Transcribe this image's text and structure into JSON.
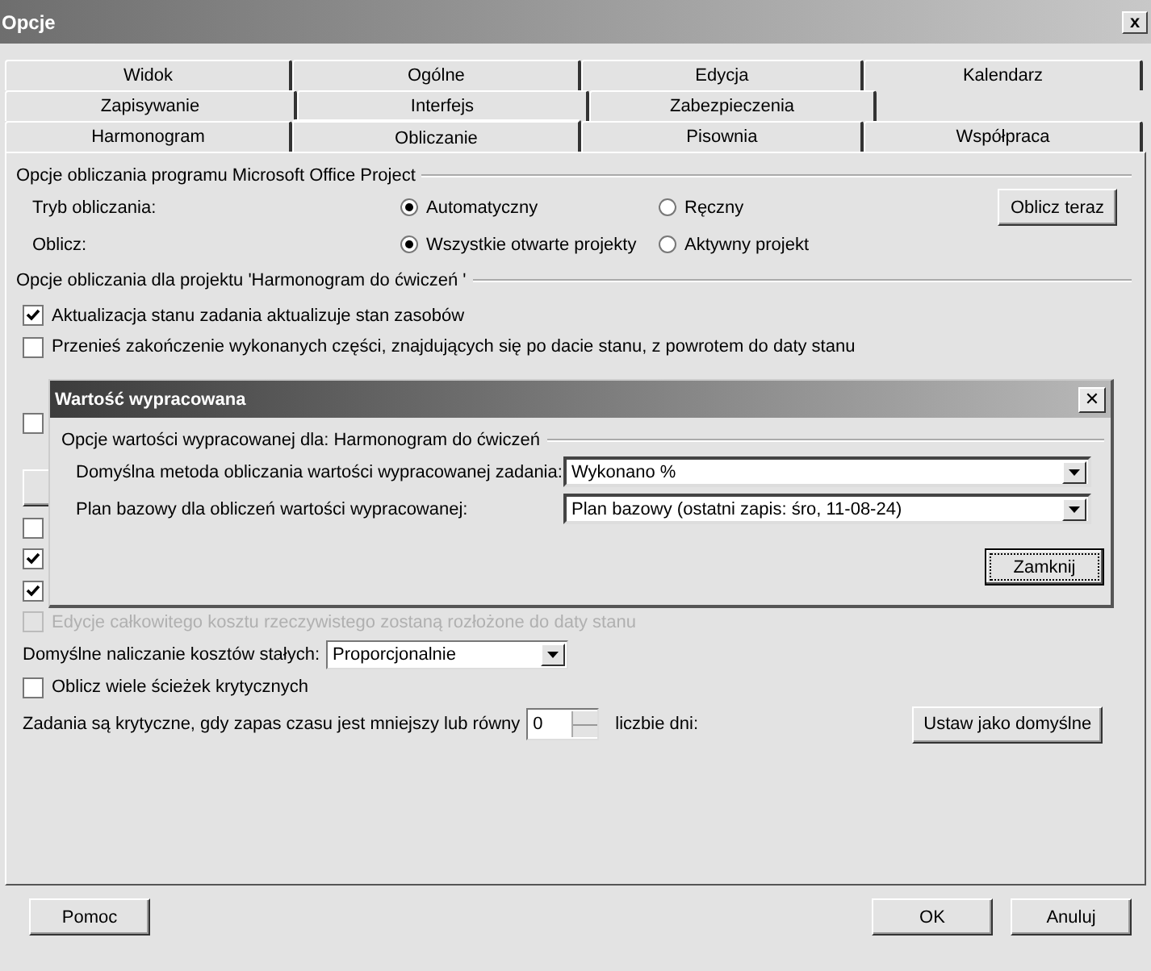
{
  "window": {
    "title": "Opcje",
    "close": "x"
  },
  "tabs": [
    [
      {
        "label": "Widok",
        "selected": false
      },
      {
        "label": "Ogólne",
        "selected": false
      },
      {
        "label": "Edycja",
        "selected": false
      },
      {
        "label": "Kalendarz",
        "selected": false
      }
    ],
    [
      {
        "label": "Zapisywanie",
        "selected": false
      },
      {
        "label": "Interfejs",
        "selected": false
      },
      {
        "label": "Zabezpieczenia",
        "selected": false
      }
    ],
    [
      {
        "label": "Harmonogram",
        "selected": false
      },
      {
        "label": "Obliczanie",
        "selected": true
      },
      {
        "label": "Pisownia",
        "selected": false
      },
      {
        "label": "Współpraca",
        "selected": false
      }
    ]
  ],
  "program_group": {
    "title": "Opcje obliczania programu Microsoft Office Project",
    "rows": [
      {
        "label": "Tryb obliczania:",
        "options": [
          {
            "label": "Automatyczny",
            "selected": true
          },
          {
            "label": "Ręczny",
            "selected": false
          }
        ],
        "button": "Oblicz teraz"
      },
      {
        "label": "Oblicz:",
        "options": [
          {
            "label": "Wszystkie otwarte projekty",
            "selected": true
          },
          {
            "label": "Aktywny projekt",
            "selected": false
          }
        ]
      }
    ]
  },
  "project_group": {
    "title": "Opcje obliczania dla projektu 'Harmonogram do ćwiczeń '",
    "items": [
      {
        "kind": "checkbox",
        "label": "Aktualizacja stanu zadania aktualizuje stan zasobów",
        "checked": true,
        "disabled": false
      },
      {
        "kind": "checkbox",
        "label": "Przenieś zakończenie wykonanych części, znajdujących się po dacie stanu, z powrotem do daty stanu",
        "checked": false,
        "disabled": false
      },
      {
        "kind": "checkbox",
        "checked": false,
        "disabled": false
      },
      {
        "kind": "button"
      },
      {
        "kind": "checkbox",
        "checked": false,
        "disabled": false
      },
      {
        "kind": "checkbox",
        "checked": true,
        "disabled": false
      },
      {
        "kind": "checkbox",
        "checked": true,
        "disabled": false
      },
      {
        "kind": "checkbox",
        "label": "Edycje całkowitego kosztu rzeczywistego zostaną rozłożone do daty stanu",
        "checked": false,
        "disabled": true
      },
      {
        "kind": "combo",
        "label": "Domyślne naliczanie kosztów stałych:",
        "value": "Proporcjonalnie"
      },
      {
        "kind": "checkbox",
        "label": "Oblicz wiele ścieżek krytycznych",
        "checked": false,
        "disabled": false
      },
      {
        "kind": "spin",
        "label": "Zadania są krytyczne, gdy zapas czasu jest mniejszy lub równy",
        "value": "0",
        "suffix": "liczbie dni:",
        "button": "Ustaw jako domyślne"
      }
    ]
  },
  "dialog": {
    "title": "Wartość wypracowana",
    "close": "✕",
    "group": "Opcje wartości wypracowanej dla: Harmonogram do ćwiczeń",
    "rows": [
      {
        "label": "Domyślna metoda obliczania wartości wypracowanej zadania:",
        "value": "Wykonano %"
      },
      {
        "label": "Plan bazowy dla obliczeń wartości wypracowanej:",
        "value": "Plan bazowy (ostatni zapis: śro, 11-08-24)"
      }
    ],
    "button": "Zamknij"
  },
  "buttons": [
    "Pomoc",
    "OK",
    "Anuluj"
  ]
}
